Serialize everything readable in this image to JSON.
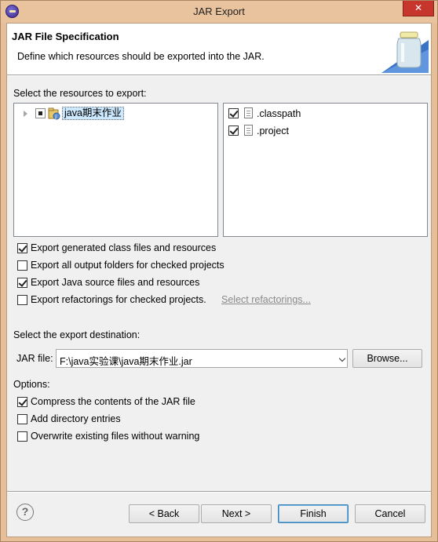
{
  "window": {
    "title": "JAR Export",
    "close_glyph": "✕"
  },
  "header": {
    "title": "JAR File Specification",
    "description": "Define which resources should be exported into the JAR."
  },
  "resources": {
    "label": "Select the resources to export:",
    "tree": [
      {
        "label": "java期末作业",
        "checked": "partial",
        "icon": "java-project-icon"
      }
    ],
    "files": [
      {
        "label": ".classpath",
        "checked": true,
        "icon": "file-icon"
      },
      {
        "label": ".project",
        "checked": true,
        "icon": "file-icon"
      }
    ]
  },
  "export_options": [
    {
      "label": "Export generated class files and resources",
      "checked": true
    },
    {
      "label": "Export all output folders for checked projects",
      "checked": false
    },
    {
      "label": "Export Java source files and resources",
      "checked": true
    },
    {
      "label": "Export refactorings for checked projects.",
      "checked": false,
      "link": "Select refactorings..."
    }
  ],
  "destination": {
    "label": "Select the export destination:",
    "jar_label": "JAR file:",
    "jar_value": "F:\\java实验课\\java期末作业.jar",
    "browse_label": "Browse..."
  },
  "options": {
    "label": "Options:",
    "items": [
      {
        "label": "Compress the contents of the JAR file",
        "checked": true
      },
      {
        "label": "Add directory entries",
        "checked": false
      },
      {
        "label": "Overwrite existing files without warning",
        "checked": false
      }
    ]
  },
  "buttons": {
    "help_glyph": "?",
    "back": "< Back",
    "next": "Next >",
    "finish": "Finish",
    "cancel": "Cancel"
  },
  "colors": {
    "title_bar": "#e9c39d",
    "close_button": "#c7362d",
    "selection": "#cce8ff",
    "default_button_border": "#3c7fb1"
  }
}
